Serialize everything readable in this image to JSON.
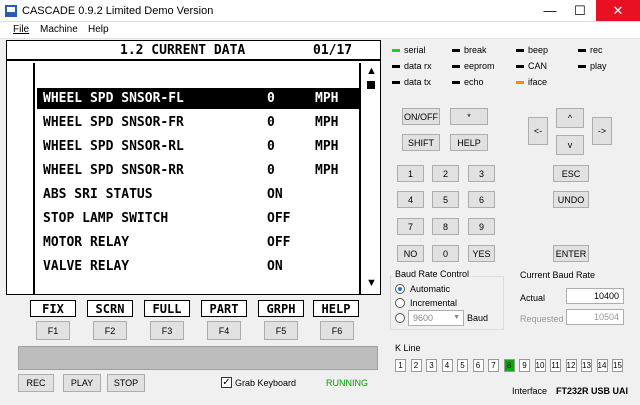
{
  "window": {
    "title": "CASCADE 0.9.2 Limited Demo Version",
    "min": "—",
    "max": "☐",
    "close": "✕"
  },
  "menu": {
    "file": "File",
    "machine": "Machine",
    "help": "Help"
  },
  "lcd": {
    "title": "1.2 CURRENT DATA",
    "page": "01/17",
    "rows": [
      {
        "label": "WHEEL SPD SNSOR-FL",
        "value": "0",
        "unit": "MPH",
        "selected": true
      },
      {
        "label": "WHEEL SPD SNSOR-FR",
        "value": "0",
        "unit": "MPH",
        "selected": false
      },
      {
        "label": "WHEEL SPD SNSOR-RL",
        "value": "0",
        "unit": "MPH",
        "selected": false
      },
      {
        "label": "WHEEL SPD SNSOR-RR",
        "value": "0",
        "unit": "MPH",
        "selected": false
      },
      {
        "label": "ABS SRI STATUS",
        "value": "ON",
        "unit": "",
        "selected": false
      },
      {
        "label": "STOP LAMP SWITCH",
        "value": "OFF",
        "unit": "",
        "selected": false
      },
      {
        "label": "MOTOR RELAY",
        "value": "OFF",
        "unit": "",
        "selected": false
      },
      {
        "label": "VALVE RELAY",
        "value": "ON",
        "unit": "",
        "selected": false
      }
    ],
    "scroll_up": "▲",
    "scroll_down": "▼"
  },
  "fkey_labels": [
    "FIX",
    "SCRN",
    "FULL",
    "PART",
    "GRPH",
    "HELP"
  ],
  "fkeys": [
    "F1",
    "F2",
    "F3",
    "F4",
    "F5",
    "F6"
  ],
  "bottom": {
    "rec": "REC",
    "play": "PLAY",
    "stop": "STOP",
    "grab_keyboard": "Grab Keyboard",
    "grab_checked": "✓",
    "status": "RUNNING"
  },
  "indicators": [
    {
      "name": "serial",
      "color": "#22cc22"
    },
    {
      "name": "break",
      "color": "#000000"
    },
    {
      "name": "beep",
      "color": "#000000"
    },
    {
      "name": "rec",
      "color": "#000000"
    },
    {
      "name": "data rx",
      "color": "#000000"
    },
    {
      "name": "eeprom",
      "color": "#000000"
    },
    {
      "name": "CAN",
      "color": "#000000"
    },
    {
      "name": "play",
      "color": "#000000"
    },
    {
      "name": "data tx",
      "color": "#000000"
    },
    {
      "name": "echo",
      "color": "#000000"
    },
    {
      "name": "iface",
      "color": "#ff8c00"
    }
  ],
  "keypad": {
    "onoff": "ON/OFF",
    "star": "*",
    "shift": "SHIFT",
    "help": "HELP",
    "digits": [
      "1",
      "2",
      "3",
      "4",
      "5",
      "6",
      "7",
      "8",
      "9"
    ],
    "no": "NO",
    "zero": "0",
    "yes": "YES",
    "esc": "ESC",
    "undo": "UNDO",
    "enter": "ENTER",
    "left": "<-",
    "right": "->",
    "up": "^",
    "down": "v"
  },
  "baud": {
    "group_title": "Baud Rate Control",
    "automatic": "Automatic",
    "incremental": "Incremental",
    "select_value": "9600",
    "select_arrow": "▼",
    "baud_label": "Baud",
    "current_title": "Current Baud Rate",
    "actual_label": "Actual",
    "actual_value": "10400",
    "requested_label": "Requested",
    "requested_value": "10504"
  },
  "kline": {
    "title": "K Line",
    "lines": [
      "1",
      "2",
      "3",
      "4",
      "5",
      "6",
      "7",
      "8",
      "9",
      "10",
      "11",
      "12",
      "13",
      "14",
      "15"
    ],
    "active": "8"
  },
  "interface": {
    "label": "Interface",
    "value": "FT232R USB UAI"
  },
  "colors": {
    "selected_row_bg": "#000000",
    "running": "#00a000",
    "kline_active": "#00b000"
  }
}
